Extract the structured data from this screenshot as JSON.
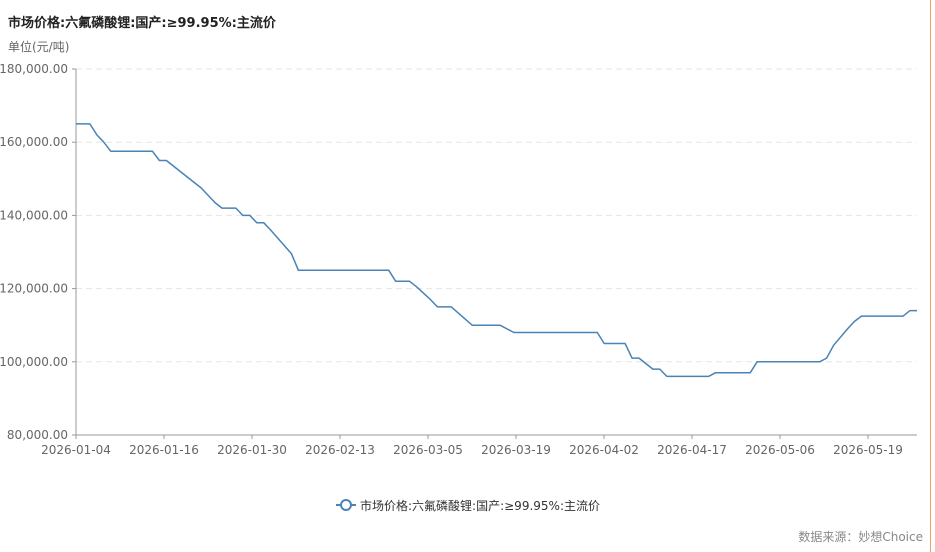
{
  "header": {
    "title": "市场价格:六氟磷酸锂:国产:≥99.95%:主流价",
    "unit": "单位(元/吨)"
  },
  "footer": {
    "source": "数据来源：妙想Choice"
  },
  "chart_data": {
    "type": "line",
    "ylim": [
      80000,
      180000
    ],
    "y_ticks": [
      "80,000.00",
      "100,000.00",
      "120,000.00",
      "140,000.00",
      "160,000.00",
      "180,000.00"
    ],
    "x_ticks": [
      "2026-01-04",
      "2026-01-16",
      "2026-01-30",
      "2026-02-13",
      "2026-03-05",
      "2026-03-19",
      "2026-04-02",
      "2026-04-17",
      "2026-05-06",
      "2026-05-19"
    ],
    "grid": "horizontal dashed",
    "legend_position": "bottom-center",
    "series": [
      {
        "name": "市场价格:六氟磷酸锂:国产:≥99.95%:主流价",
        "color": "#4a83b5",
        "points": [
          [
            "2026-01-04",
            165000
          ],
          [
            "2026-01-06",
            165000
          ],
          [
            "2026-01-07",
            162000
          ],
          [
            "2026-01-08",
            160000
          ],
          [
            "2026-01-09",
            157500
          ],
          [
            "2026-01-15",
            157500
          ],
          [
            "2026-01-16",
            155000
          ],
          [
            "2026-01-17",
            155000
          ],
          [
            "2026-01-21",
            149000
          ],
          [
            "2026-01-22",
            147500
          ],
          [
            "2026-01-24",
            143500
          ],
          [
            "2026-01-25",
            142000
          ],
          [
            "2026-01-27",
            142000
          ],
          [
            "2026-01-28",
            140000
          ],
          [
            "2026-01-29",
            140000
          ],
          [
            "2026-01-30",
            138000
          ],
          [
            "2026-01-31",
            138000
          ],
          [
            "2026-02-01",
            136000
          ],
          [
            "2026-02-04",
            129500
          ],
          [
            "2026-02-05",
            125000
          ],
          [
            "2026-02-18",
            125000
          ],
          [
            "2026-02-19",
            122000
          ],
          [
            "2026-02-21",
            122000
          ],
          [
            "2026-02-22",
            120500
          ],
          [
            "2026-02-24",
            117000
          ],
          [
            "2026-02-25",
            115000
          ],
          [
            "2026-02-27",
            115000
          ],
          [
            "2026-03-02",
            110000
          ],
          [
            "2026-03-06",
            110000
          ],
          [
            "2026-03-08",
            108000
          ],
          [
            "2026-03-20",
            108000
          ],
          [
            "2026-03-21",
            105000
          ],
          [
            "2026-03-24",
            105000
          ],
          [
            "2026-03-25",
            101000
          ],
          [
            "2026-03-26",
            101000
          ],
          [
            "2026-03-28",
            98000
          ],
          [
            "2026-03-29",
            98000
          ],
          [
            "2026-03-30",
            96000
          ],
          [
            "2026-04-05",
            96000
          ],
          [
            "2026-04-06",
            97000
          ],
          [
            "2026-04-11",
            97000
          ],
          [
            "2026-04-12",
            100000
          ],
          [
            "2026-04-21",
            100000
          ],
          [
            "2026-04-22",
            101000
          ],
          [
            "2026-04-23",
            104500
          ],
          [
            "2026-04-25",
            109000
          ],
          [
            "2026-04-26",
            111000
          ],
          [
            "2026-04-27",
            112500
          ],
          [
            "2026-05-03",
            112500
          ],
          [
            "2026-05-04",
            114000
          ],
          [
            "2026-05-05",
            114000
          ]
        ]
      }
    ]
  }
}
